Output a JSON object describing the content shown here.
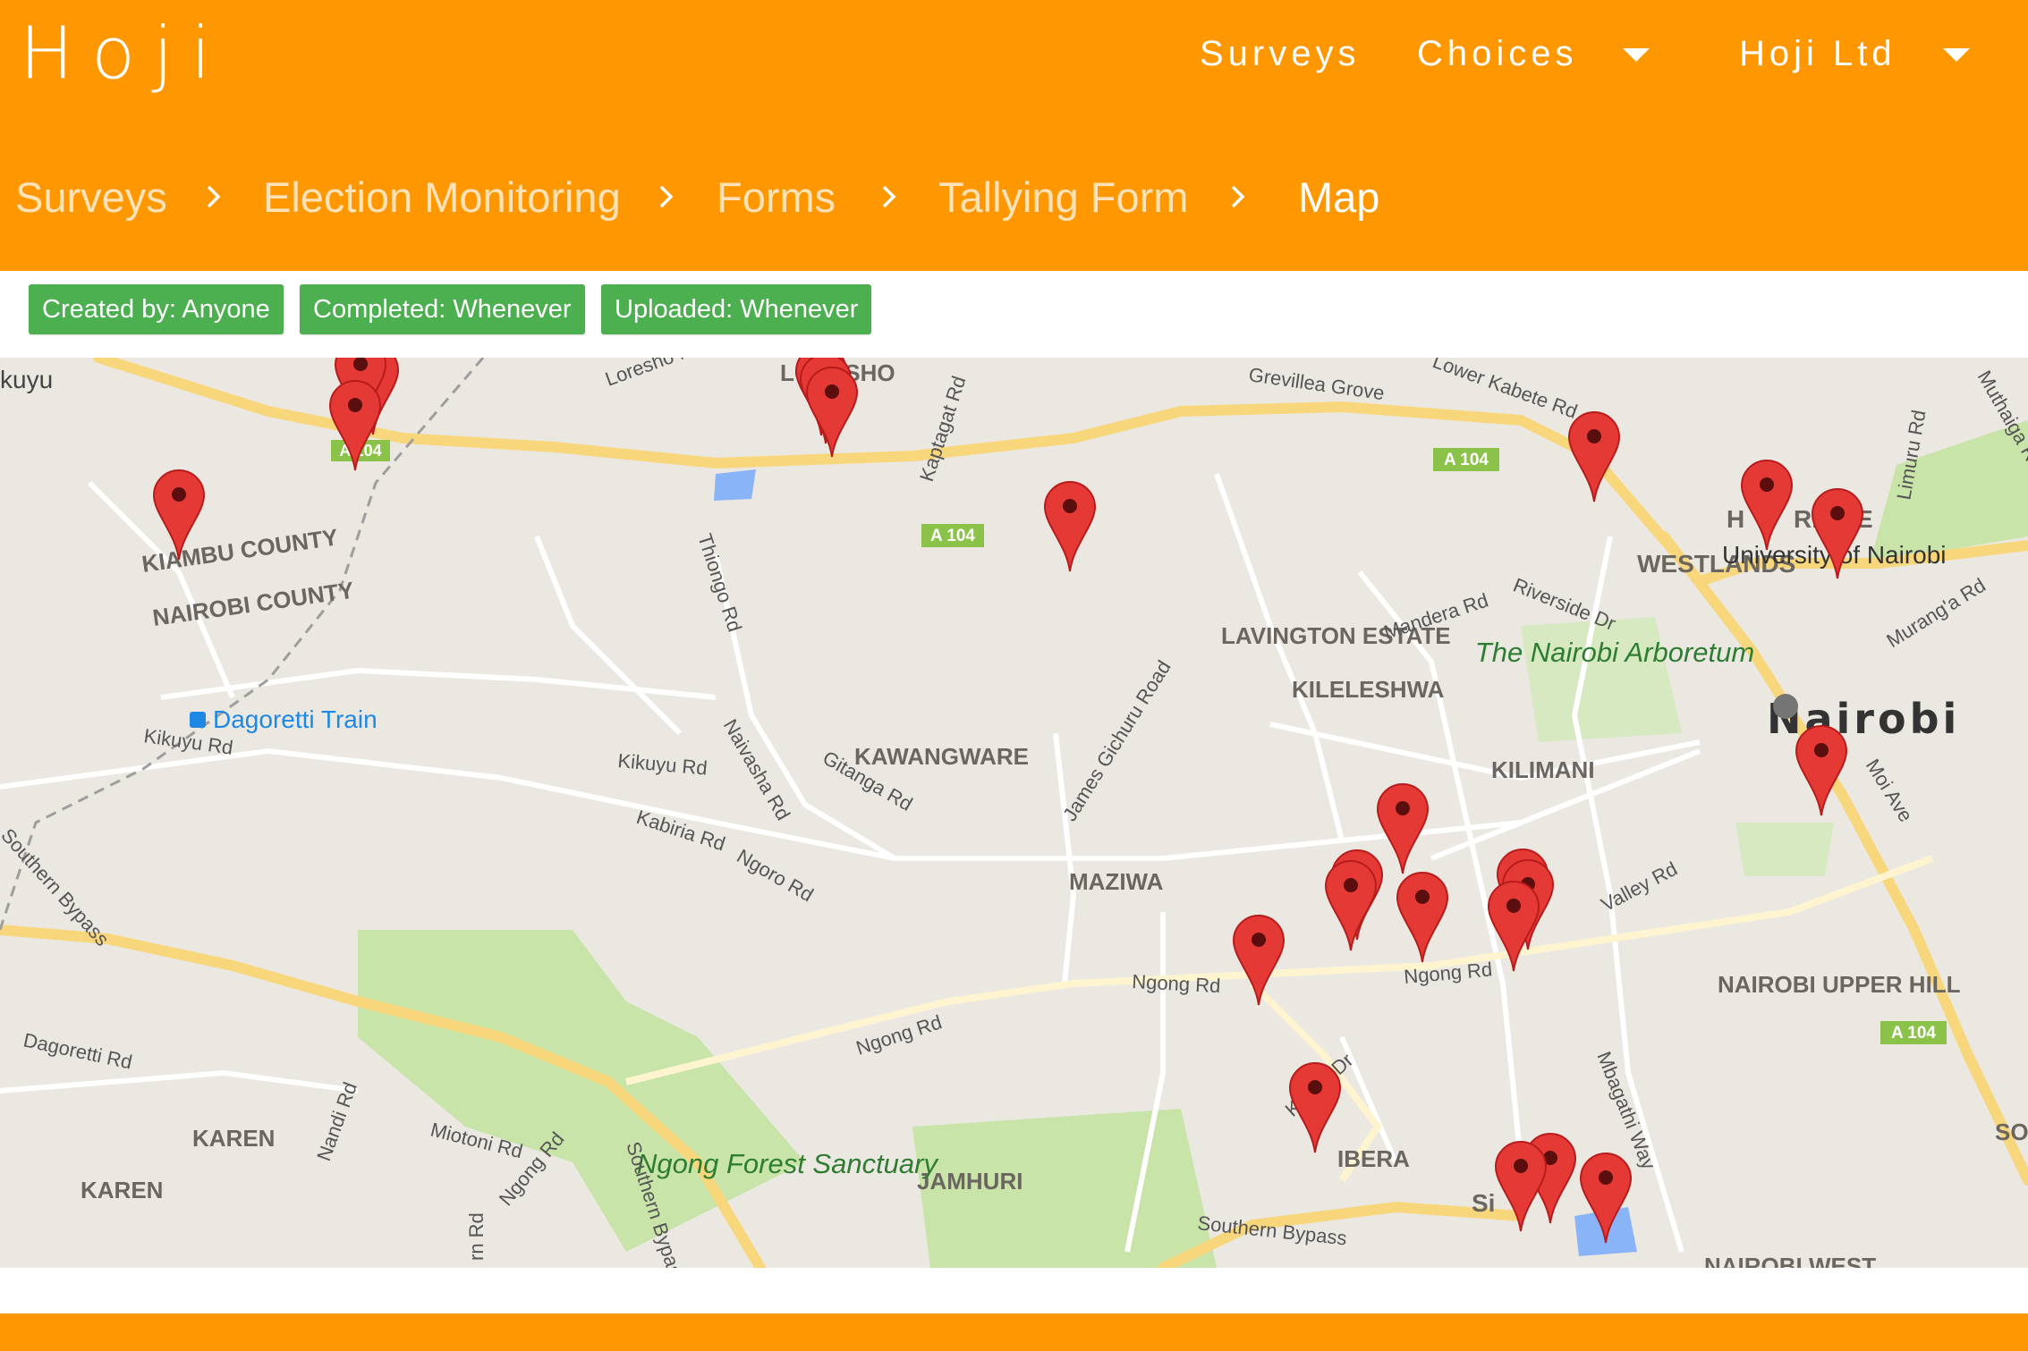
{
  "app": {
    "logo": "Hoji"
  },
  "nav": {
    "surveys": "Surveys",
    "choices": "Choices",
    "account": "Hoji Ltd"
  },
  "breadcrumb": [
    "Surveys",
    "Election Monitoring",
    "Forms",
    "Tallying Form",
    "Map"
  ],
  "filters": [
    "Created by: Anyone",
    "Completed: Whenever",
    "Uploaded: Whenever"
  ],
  "colors": {
    "brand": "#ff9800",
    "chip": "#4caf50",
    "marker": "#e53935",
    "road_major": "#f8d77c",
    "park": "#c9e4a8"
  },
  "map": {
    "districts": [
      "LORESHO",
      "KAWANGWARE",
      "MAZIWA",
      "LAVINGTON ESTATE",
      "KILELESHWA",
      "KILIMANI",
      "WESTLANDS",
      "KAREN",
      "KAREN",
      "JAMHURI",
      "IBERA",
      "NAIROBI UPPER HILL",
      "SOUT",
      "NAIROBI WEST"
    ],
    "county_labels": [
      "KIAMBU COUNTY",
      "NAIROBI COUNTY"
    ],
    "city": "Nairobi",
    "parks": [
      "The Nairobi Arboretum",
      "Ngong Forest Sanctuary"
    ],
    "landmarks": [
      "University of Nairobi",
      "Dagoretti Train"
    ],
    "roads": [
      "Kikuyu Rd",
      "Kikuyu Rd",
      "Naivasha Rd",
      "Gitanga Rd",
      "Kabiria Rd",
      "Ngoro Rd",
      "Ngong Rd",
      "Ngong Rd",
      "Ngong Rd",
      "Southern Bypass",
      "Southern Bypass",
      "Southern Bypass",
      "Dagoretti Rd",
      "Miotoni Rd",
      "Nandi Rd",
      "Ngong Rd",
      "Kibera Dr",
      "Mbagathi Way",
      "Valley Rd",
      "Moi Ave",
      "Murang'a Rd",
      "Limuru Rd",
      "Riverside Dr",
      "Mandera Rd",
      "James Gichuru Road",
      "Kaptagat Rd",
      "Thiongo Rd",
      "Grevillea Grove",
      "Lower Kabete Rd",
      "Loresho Rd",
      "Muthaiga Rd"
    ],
    "road_shields": [
      "A 104",
      "A 104",
      "A 104",
      "A 104"
    ],
    "extra_text": [
      "kuyu",
      "H",
      "RIDGE",
      "Si",
      "rn Rd"
    ],
    "marker_count": 28
  }
}
